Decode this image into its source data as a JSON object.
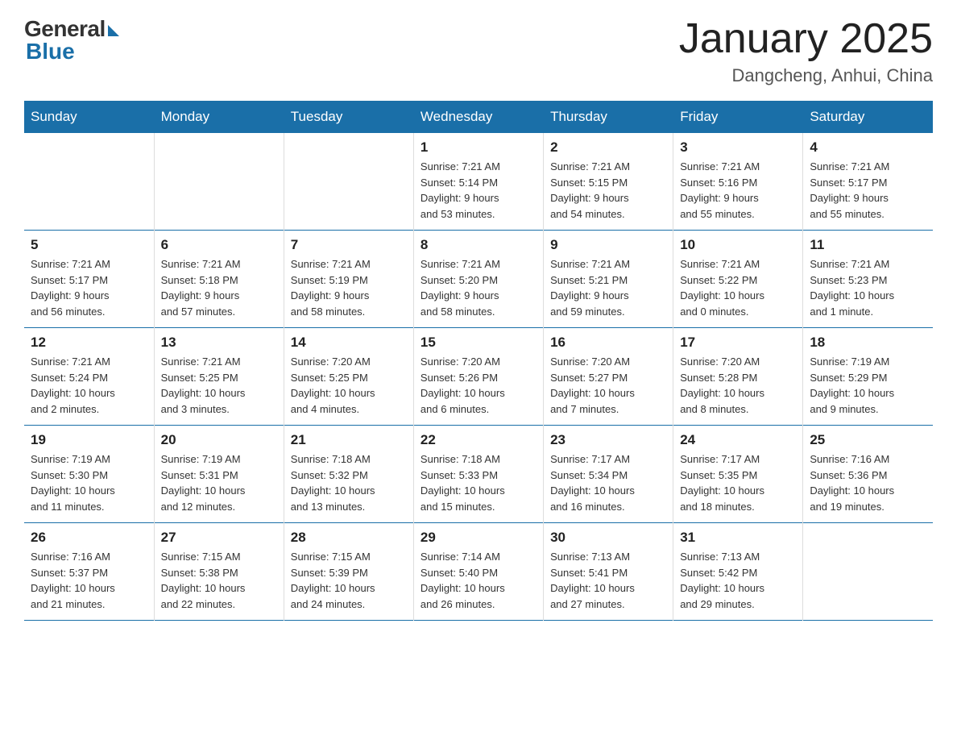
{
  "header": {
    "logo_general": "General",
    "logo_blue": "Blue",
    "title": "January 2025",
    "location": "Dangcheng, Anhui, China"
  },
  "days_of_week": [
    "Sunday",
    "Monday",
    "Tuesday",
    "Wednesday",
    "Thursday",
    "Friday",
    "Saturday"
  ],
  "weeks": [
    [
      {
        "day": "",
        "info": ""
      },
      {
        "day": "",
        "info": ""
      },
      {
        "day": "",
        "info": ""
      },
      {
        "day": "1",
        "info": "Sunrise: 7:21 AM\nSunset: 5:14 PM\nDaylight: 9 hours\nand 53 minutes."
      },
      {
        "day": "2",
        "info": "Sunrise: 7:21 AM\nSunset: 5:15 PM\nDaylight: 9 hours\nand 54 minutes."
      },
      {
        "day": "3",
        "info": "Sunrise: 7:21 AM\nSunset: 5:16 PM\nDaylight: 9 hours\nand 55 minutes."
      },
      {
        "day": "4",
        "info": "Sunrise: 7:21 AM\nSunset: 5:17 PM\nDaylight: 9 hours\nand 55 minutes."
      }
    ],
    [
      {
        "day": "5",
        "info": "Sunrise: 7:21 AM\nSunset: 5:17 PM\nDaylight: 9 hours\nand 56 minutes."
      },
      {
        "day": "6",
        "info": "Sunrise: 7:21 AM\nSunset: 5:18 PM\nDaylight: 9 hours\nand 57 minutes."
      },
      {
        "day": "7",
        "info": "Sunrise: 7:21 AM\nSunset: 5:19 PM\nDaylight: 9 hours\nand 58 minutes."
      },
      {
        "day": "8",
        "info": "Sunrise: 7:21 AM\nSunset: 5:20 PM\nDaylight: 9 hours\nand 58 minutes."
      },
      {
        "day": "9",
        "info": "Sunrise: 7:21 AM\nSunset: 5:21 PM\nDaylight: 9 hours\nand 59 minutes."
      },
      {
        "day": "10",
        "info": "Sunrise: 7:21 AM\nSunset: 5:22 PM\nDaylight: 10 hours\nand 0 minutes."
      },
      {
        "day": "11",
        "info": "Sunrise: 7:21 AM\nSunset: 5:23 PM\nDaylight: 10 hours\nand 1 minute."
      }
    ],
    [
      {
        "day": "12",
        "info": "Sunrise: 7:21 AM\nSunset: 5:24 PM\nDaylight: 10 hours\nand 2 minutes."
      },
      {
        "day": "13",
        "info": "Sunrise: 7:21 AM\nSunset: 5:25 PM\nDaylight: 10 hours\nand 3 minutes."
      },
      {
        "day": "14",
        "info": "Sunrise: 7:20 AM\nSunset: 5:25 PM\nDaylight: 10 hours\nand 4 minutes."
      },
      {
        "day": "15",
        "info": "Sunrise: 7:20 AM\nSunset: 5:26 PM\nDaylight: 10 hours\nand 6 minutes."
      },
      {
        "day": "16",
        "info": "Sunrise: 7:20 AM\nSunset: 5:27 PM\nDaylight: 10 hours\nand 7 minutes."
      },
      {
        "day": "17",
        "info": "Sunrise: 7:20 AM\nSunset: 5:28 PM\nDaylight: 10 hours\nand 8 minutes."
      },
      {
        "day": "18",
        "info": "Sunrise: 7:19 AM\nSunset: 5:29 PM\nDaylight: 10 hours\nand 9 minutes."
      }
    ],
    [
      {
        "day": "19",
        "info": "Sunrise: 7:19 AM\nSunset: 5:30 PM\nDaylight: 10 hours\nand 11 minutes."
      },
      {
        "day": "20",
        "info": "Sunrise: 7:19 AM\nSunset: 5:31 PM\nDaylight: 10 hours\nand 12 minutes."
      },
      {
        "day": "21",
        "info": "Sunrise: 7:18 AM\nSunset: 5:32 PM\nDaylight: 10 hours\nand 13 minutes."
      },
      {
        "day": "22",
        "info": "Sunrise: 7:18 AM\nSunset: 5:33 PM\nDaylight: 10 hours\nand 15 minutes."
      },
      {
        "day": "23",
        "info": "Sunrise: 7:17 AM\nSunset: 5:34 PM\nDaylight: 10 hours\nand 16 minutes."
      },
      {
        "day": "24",
        "info": "Sunrise: 7:17 AM\nSunset: 5:35 PM\nDaylight: 10 hours\nand 18 minutes."
      },
      {
        "day": "25",
        "info": "Sunrise: 7:16 AM\nSunset: 5:36 PM\nDaylight: 10 hours\nand 19 minutes."
      }
    ],
    [
      {
        "day": "26",
        "info": "Sunrise: 7:16 AM\nSunset: 5:37 PM\nDaylight: 10 hours\nand 21 minutes."
      },
      {
        "day": "27",
        "info": "Sunrise: 7:15 AM\nSunset: 5:38 PM\nDaylight: 10 hours\nand 22 minutes."
      },
      {
        "day": "28",
        "info": "Sunrise: 7:15 AM\nSunset: 5:39 PM\nDaylight: 10 hours\nand 24 minutes."
      },
      {
        "day": "29",
        "info": "Sunrise: 7:14 AM\nSunset: 5:40 PM\nDaylight: 10 hours\nand 26 minutes."
      },
      {
        "day": "30",
        "info": "Sunrise: 7:13 AM\nSunset: 5:41 PM\nDaylight: 10 hours\nand 27 minutes."
      },
      {
        "day": "31",
        "info": "Sunrise: 7:13 AM\nSunset: 5:42 PM\nDaylight: 10 hours\nand 29 minutes."
      },
      {
        "day": "",
        "info": ""
      }
    ]
  ]
}
